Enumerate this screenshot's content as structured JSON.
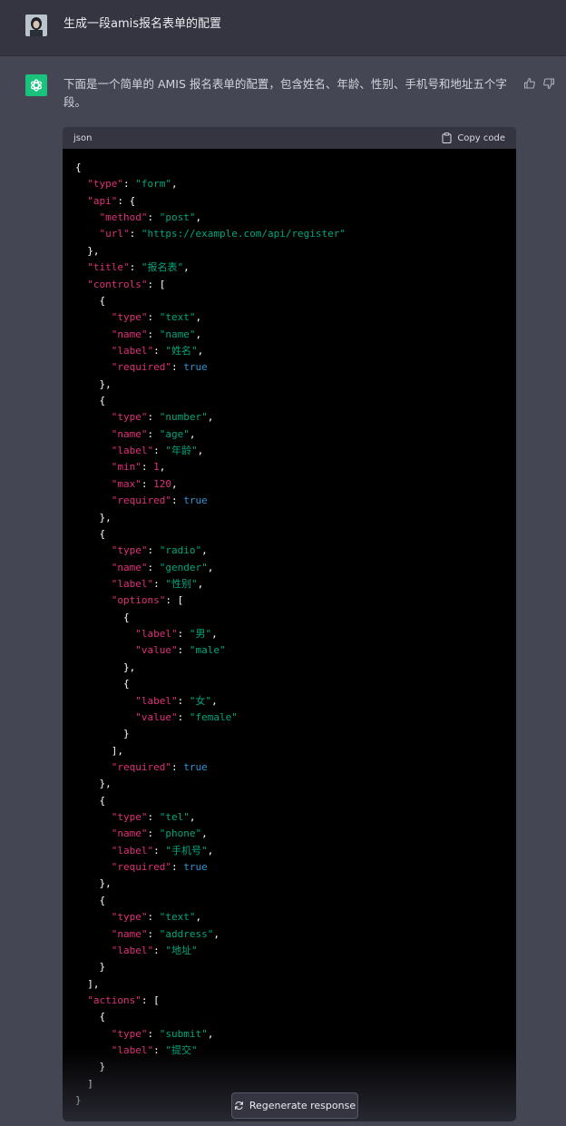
{
  "user_message": {
    "text": "生成一段amis报名表单的配置"
  },
  "assistant_message": {
    "text": "下面是一个简单的 AMIS 报名表单的配置，包含姓名、年龄、性别、手机号和地址五个字段。"
  },
  "code_block": {
    "language": "json",
    "copy_label": "Copy code",
    "lines": [
      [
        [
          "p",
          "{"
        ]
      ],
      [
        [
          "s",
          "  "
        ],
        [
          "k",
          "\"type\""
        ],
        [
          "p",
          ": "
        ],
        [
          "v",
          "\"form\""
        ],
        [
          "p",
          ","
        ]
      ],
      [
        [
          "s",
          "  "
        ],
        [
          "k",
          "\"api\""
        ],
        [
          "p",
          ": {"
        ]
      ],
      [
        [
          "s",
          "    "
        ],
        [
          "k",
          "\"method\""
        ],
        [
          "p",
          ": "
        ],
        [
          "v",
          "\"post\""
        ],
        [
          "p",
          ","
        ]
      ],
      [
        [
          "s",
          "    "
        ],
        [
          "k",
          "\"url\""
        ],
        [
          "p",
          ": "
        ],
        [
          "v",
          "\"https://example.com/api/register\""
        ]
      ],
      [
        [
          "s",
          "  "
        ],
        [
          "p",
          "},"
        ]
      ],
      [
        [
          "s",
          "  "
        ],
        [
          "k",
          "\"title\""
        ],
        [
          "p",
          ": "
        ],
        [
          "v",
          "\"报名表\""
        ],
        [
          "p",
          ","
        ]
      ],
      [
        [
          "s",
          "  "
        ],
        [
          "k",
          "\"controls\""
        ],
        [
          "p",
          ": ["
        ]
      ],
      [
        [
          "s",
          "    "
        ],
        [
          "p",
          "{"
        ]
      ],
      [
        [
          "s",
          "      "
        ],
        [
          "k",
          "\"type\""
        ],
        [
          "p",
          ": "
        ],
        [
          "v",
          "\"text\""
        ],
        [
          "p",
          ","
        ]
      ],
      [
        [
          "s",
          "      "
        ],
        [
          "k",
          "\"name\""
        ],
        [
          "p",
          ": "
        ],
        [
          "v",
          "\"name\""
        ],
        [
          "p",
          ","
        ]
      ],
      [
        [
          "s",
          "      "
        ],
        [
          "k",
          "\"label\""
        ],
        [
          "p",
          ": "
        ],
        [
          "v",
          "\"姓名\""
        ],
        [
          "p",
          ","
        ]
      ],
      [
        [
          "s",
          "      "
        ],
        [
          "k",
          "\"required\""
        ],
        [
          "p",
          ": "
        ],
        [
          "b",
          "true"
        ]
      ],
      [
        [
          "s",
          "    "
        ],
        [
          "p",
          "},"
        ]
      ],
      [
        [
          "s",
          "    "
        ],
        [
          "p",
          "{"
        ]
      ],
      [
        [
          "s",
          "      "
        ],
        [
          "k",
          "\"type\""
        ],
        [
          "p",
          ": "
        ],
        [
          "v",
          "\"number\""
        ],
        [
          "p",
          ","
        ]
      ],
      [
        [
          "s",
          "      "
        ],
        [
          "k",
          "\"name\""
        ],
        [
          "p",
          ": "
        ],
        [
          "v",
          "\"age\""
        ],
        [
          "p",
          ","
        ]
      ],
      [
        [
          "s",
          "      "
        ],
        [
          "k",
          "\"label\""
        ],
        [
          "p",
          ": "
        ],
        [
          "v",
          "\"年龄\""
        ],
        [
          "p",
          ","
        ]
      ],
      [
        [
          "s",
          "      "
        ],
        [
          "k",
          "\"min\""
        ],
        [
          "p",
          ": "
        ],
        [
          "n",
          "1"
        ],
        [
          "p",
          ","
        ]
      ],
      [
        [
          "s",
          "      "
        ],
        [
          "k",
          "\"max\""
        ],
        [
          "p",
          ": "
        ],
        [
          "n",
          "120"
        ],
        [
          "p",
          ","
        ]
      ],
      [
        [
          "s",
          "      "
        ],
        [
          "k",
          "\"required\""
        ],
        [
          "p",
          ": "
        ],
        [
          "b",
          "true"
        ]
      ],
      [
        [
          "s",
          "    "
        ],
        [
          "p",
          "},"
        ]
      ],
      [
        [
          "s",
          "    "
        ],
        [
          "p",
          "{"
        ]
      ],
      [
        [
          "s",
          "      "
        ],
        [
          "k",
          "\"type\""
        ],
        [
          "p",
          ": "
        ],
        [
          "v",
          "\"radio\""
        ],
        [
          "p",
          ","
        ]
      ],
      [
        [
          "s",
          "      "
        ],
        [
          "k",
          "\"name\""
        ],
        [
          "p",
          ": "
        ],
        [
          "v",
          "\"gender\""
        ],
        [
          "p",
          ","
        ]
      ],
      [
        [
          "s",
          "      "
        ],
        [
          "k",
          "\"label\""
        ],
        [
          "p",
          ": "
        ],
        [
          "v",
          "\"性别\""
        ],
        [
          "p",
          ","
        ]
      ],
      [
        [
          "s",
          "      "
        ],
        [
          "k",
          "\"options\""
        ],
        [
          "p",
          ": ["
        ]
      ],
      [
        [
          "s",
          "        "
        ],
        [
          "p",
          "{"
        ]
      ],
      [
        [
          "s",
          "          "
        ],
        [
          "k",
          "\"label\""
        ],
        [
          "p",
          ": "
        ],
        [
          "v",
          "\"男\""
        ],
        [
          "p",
          ","
        ]
      ],
      [
        [
          "s",
          "          "
        ],
        [
          "k",
          "\"value\""
        ],
        [
          "p",
          ": "
        ],
        [
          "v",
          "\"male\""
        ]
      ],
      [
        [
          "s",
          "        "
        ],
        [
          "p",
          "},"
        ]
      ],
      [
        [
          "s",
          "        "
        ],
        [
          "p",
          "{"
        ]
      ],
      [
        [
          "s",
          "          "
        ],
        [
          "k",
          "\"label\""
        ],
        [
          "p",
          ": "
        ],
        [
          "v",
          "\"女\""
        ],
        [
          "p",
          ","
        ]
      ],
      [
        [
          "s",
          "          "
        ],
        [
          "k",
          "\"value\""
        ],
        [
          "p",
          ": "
        ],
        [
          "v",
          "\"female\""
        ]
      ],
      [
        [
          "s",
          "        "
        ],
        [
          "p",
          "}"
        ]
      ],
      [
        [
          "s",
          "      "
        ],
        [
          "p",
          "],"
        ]
      ],
      [
        [
          "s",
          "      "
        ],
        [
          "k",
          "\"required\""
        ],
        [
          "p",
          ": "
        ],
        [
          "b",
          "true"
        ]
      ],
      [
        [
          "s",
          "    "
        ],
        [
          "p",
          "},"
        ]
      ],
      [
        [
          "s",
          "    "
        ],
        [
          "p",
          "{"
        ]
      ],
      [
        [
          "s",
          "      "
        ],
        [
          "k",
          "\"type\""
        ],
        [
          "p",
          ": "
        ],
        [
          "v",
          "\"tel\""
        ],
        [
          "p",
          ","
        ]
      ],
      [
        [
          "s",
          "      "
        ],
        [
          "k",
          "\"name\""
        ],
        [
          "p",
          ": "
        ],
        [
          "v",
          "\"phone\""
        ],
        [
          "p",
          ","
        ]
      ],
      [
        [
          "s",
          "      "
        ],
        [
          "k",
          "\"label\""
        ],
        [
          "p",
          ": "
        ],
        [
          "v",
          "\"手机号\""
        ],
        [
          "p",
          ","
        ]
      ],
      [
        [
          "s",
          "      "
        ],
        [
          "k",
          "\"required\""
        ],
        [
          "p",
          ": "
        ],
        [
          "b",
          "true"
        ]
      ],
      [
        [
          "s",
          "    "
        ],
        [
          "p",
          "},"
        ]
      ],
      [
        [
          "s",
          "    "
        ],
        [
          "p",
          "{"
        ]
      ],
      [
        [
          "s",
          "      "
        ],
        [
          "k",
          "\"type\""
        ],
        [
          "p",
          ": "
        ],
        [
          "v",
          "\"text\""
        ],
        [
          "p",
          ","
        ]
      ],
      [
        [
          "s",
          "      "
        ],
        [
          "k",
          "\"name\""
        ],
        [
          "p",
          ": "
        ],
        [
          "v",
          "\"address\""
        ],
        [
          "p",
          ","
        ]
      ],
      [
        [
          "s",
          "      "
        ],
        [
          "k",
          "\"label\""
        ],
        [
          "p",
          ": "
        ],
        [
          "v",
          "\"地址\""
        ]
      ],
      [
        [
          "s",
          "    "
        ],
        [
          "p",
          "}"
        ]
      ],
      [
        [
          "s",
          "  "
        ],
        [
          "p",
          "],"
        ]
      ],
      [
        [
          "s",
          "  "
        ],
        [
          "k",
          "\"actions\""
        ],
        [
          "p",
          ": ["
        ]
      ],
      [
        [
          "s",
          "    "
        ],
        [
          "p",
          "{"
        ]
      ],
      [
        [
          "s",
          "      "
        ],
        [
          "k",
          "\"type\""
        ],
        [
          "p",
          ": "
        ],
        [
          "v",
          "\"submit\""
        ],
        [
          "p",
          ","
        ]
      ],
      [
        [
          "s",
          "      "
        ],
        [
          "k",
          "\"label\""
        ],
        [
          "p",
          ": "
        ],
        [
          "v",
          "\"提交\""
        ]
      ],
      [
        [
          "s",
          "    "
        ],
        [
          "p",
          "}"
        ]
      ],
      [
        [
          "s",
          "  "
        ],
        [
          "p",
          "]"
        ]
      ],
      [
        [
          "p",
          "}"
        ]
      ]
    ]
  },
  "regenerate_label": "Regenerate response",
  "colors": {
    "page_bg": "#444654",
    "user_row_bg": "#343541",
    "bot_avatar": "#19c37d",
    "code_bg": "#000000",
    "code_header_bg": "#343541",
    "token_key": "#df3079",
    "token_string": "#00a67d",
    "token_bool": "#2e95d3"
  },
  "icons": {
    "user_avatar": "user-avatar-photo",
    "bot_avatar": "openai-logo-icon",
    "thumbs_up": "thumbs-up-icon",
    "thumbs_down": "thumbs-down-icon",
    "copy": "clipboard-icon",
    "regenerate": "refresh-icon"
  }
}
